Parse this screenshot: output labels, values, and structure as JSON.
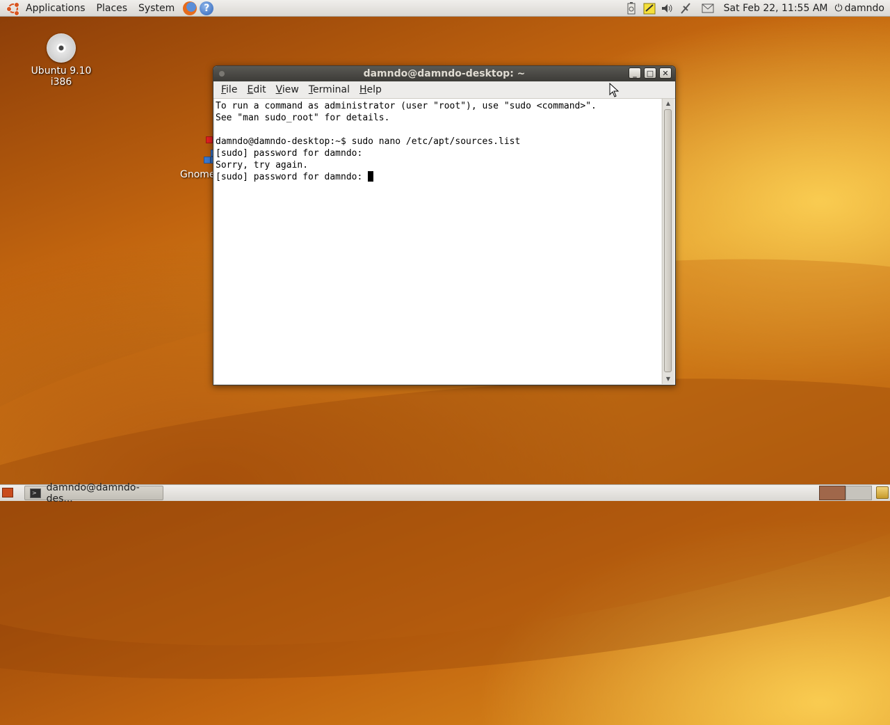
{
  "top_panel": {
    "menus": [
      "Applications",
      "Places",
      "System"
    ],
    "tray_icons": [
      "battery-icon",
      "notes-icon",
      "volume-icon",
      "network-icon",
      "mail-icon"
    ],
    "clock": "Sat Feb 22, 11:55 AM",
    "user": "damndo"
  },
  "desktop": {
    "icons": [
      {
        "label": "Ubuntu 9.10 i386",
        "icon": "cd-icon"
      },
      {
        "label": "Gnome",
        "icon": "tetris-icon"
      }
    ]
  },
  "terminal": {
    "title": "damndo@damndo-desktop: ~",
    "menu": [
      {
        "label": "File",
        "accel": "F",
        "rest": "ile"
      },
      {
        "label": "Edit",
        "accel": "E",
        "rest": "dit"
      },
      {
        "label": "View",
        "accel": "V",
        "rest": "iew"
      },
      {
        "label": "Terminal",
        "accel": "T",
        "rest": "erminal"
      },
      {
        "label": "Help",
        "accel": "H",
        "rest": "elp"
      }
    ],
    "lines": [
      "To run a command as administrator (user \"root\"), use \"sudo <command>\".",
      "See \"man sudo_root\" for details.",
      "",
      "damndo@damndo-desktop:~$ sudo nano /etc/apt/sources.list",
      "[sudo] password for damndo:",
      "Sorry, try again.",
      "[sudo] password for damndo: "
    ]
  },
  "taskbar": {
    "task_label": "damndo@damndo-des..."
  }
}
